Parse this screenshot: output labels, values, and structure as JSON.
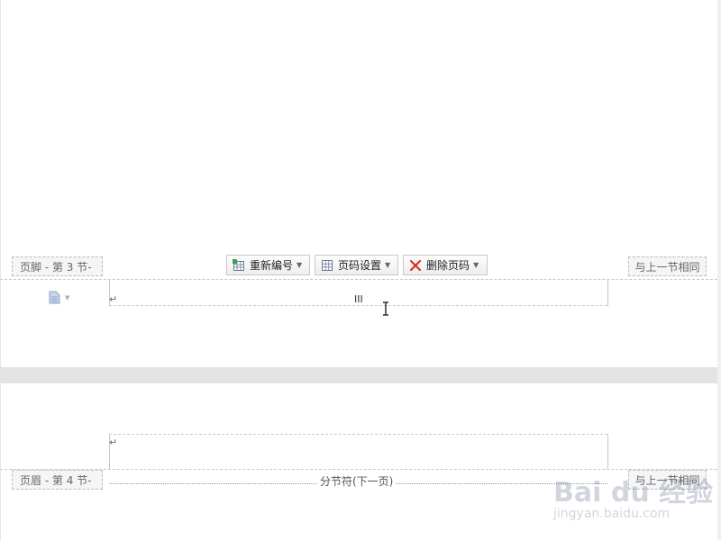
{
  "footer_area": {
    "section_tag": "页脚 - 第 3 节-",
    "same_as_previous": "与上一节相同",
    "page_number": "III",
    "para_mark": "↵"
  },
  "toolbar": {
    "renumber_label": "重新编号",
    "page_setup_label": "页码设置",
    "delete_label": "删除页码"
  },
  "header_area": {
    "section_tag": "页眉 - 第 4 节-",
    "same_as_previous": "与上一节相同",
    "para_mark": "↵",
    "section_break": "分节符(下一页)"
  },
  "watermark": {
    "logo": "Bai du 经验",
    "url": "jingyan.baidu.com"
  },
  "icons": {
    "renumber": "renumber-grid-icon",
    "page_setup": "page-setup-grid-icon",
    "delete": "delete-x-icon",
    "doc": "document-icon",
    "cursor": "text-cursor-icon"
  },
  "colors": {
    "delete_x": "#d9302b",
    "renumber_green": "#3aa040",
    "doc_blue": "#8fa3c8"
  }
}
